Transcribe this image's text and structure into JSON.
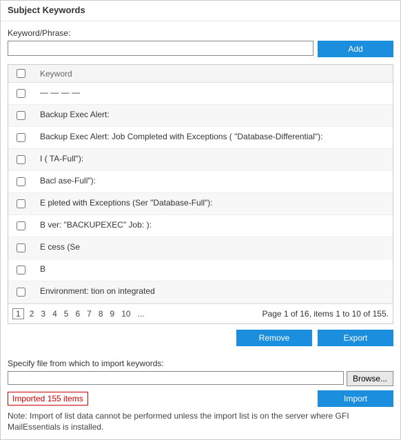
{
  "panel": {
    "title": "Subject Keywords",
    "keyword_label": "Keyword/Phrase:",
    "add_label": "Add"
  },
  "grid": {
    "header_keyword": "Keyword",
    "rows": [
      {
        "text": "— — — —"
      },
      {
        "text": "Backup Exec Alert:"
      },
      {
        "text": "Backup Exec Alert: Job Completed with Exceptions (                         \"Database-Differential\"):"
      },
      {
        "text": "I                                          (                                                        TA-Full\"):"
      },
      {
        "text": "Bacl                                                                              ase-Full\"):"
      },
      {
        "text": "E                                          pleted with Exceptions (Ser                              \"Database-Full\"):"
      },
      {
        "text": "B                                          ver: \"BACKUPEXEC\" Job:                                  ):"
      },
      {
        "text": "E                              cess (Se"
      },
      {
        "text": "B"
      },
      {
        "text": "Environment:                                          tion on integrated"
      }
    ],
    "pager": {
      "pages": [
        "1",
        "2",
        "3",
        "4",
        "5",
        "6",
        "7",
        "8",
        "9",
        "10",
        "..."
      ],
      "current": "1",
      "summary": "Page 1 of 16, items 1 to 10 of 155."
    }
  },
  "actions": {
    "remove": "Remove",
    "export": "Export"
  },
  "import": {
    "label": "Specify file from which to import keywords:",
    "browse": "Browse...",
    "status": "Imported 155 items",
    "import_btn": "Import",
    "note": "Note: Import of list data cannot be performed unless the import list is on the server where GFI MailEssentials is installed."
  }
}
